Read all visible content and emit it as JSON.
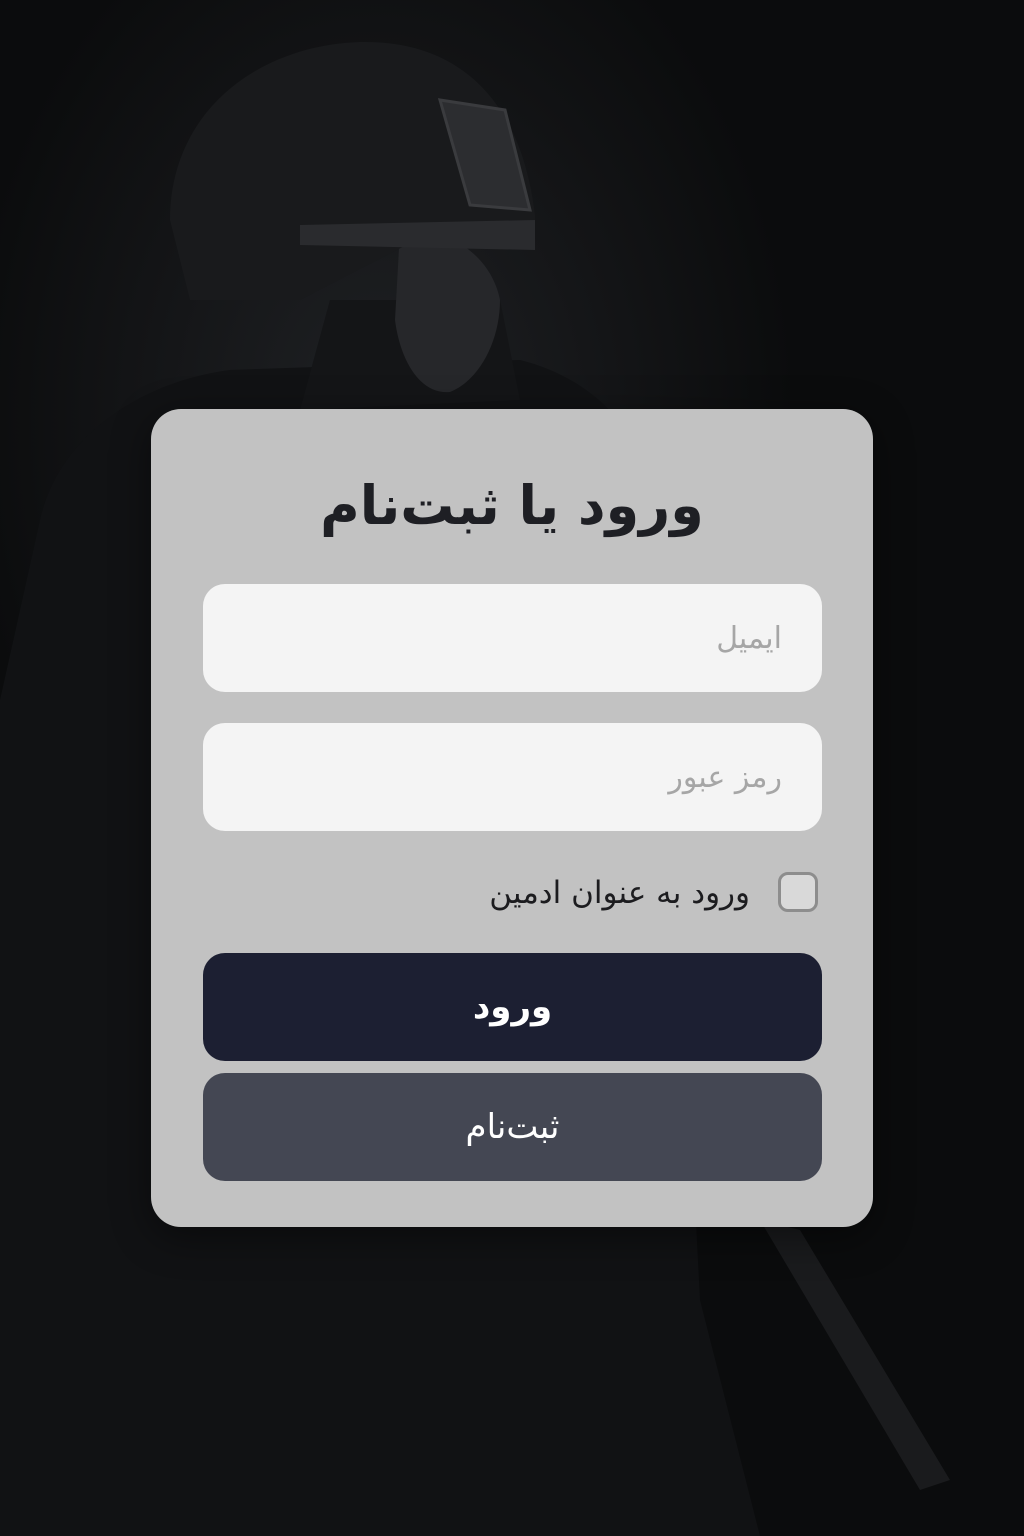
{
  "title": "ورود یا ثبت‌نام",
  "email_field": {
    "placeholder": "ایمیل",
    "value": ""
  },
  "password_field": {
    "placeholder": "رمز عبور",
    "value": ""
  },
  "admin_checkbox": {
    "label": "ورود به عنوان ادمین",
    "checked": false
  },
  "buttons": {
    "login_label": "ورود",
    "signup_label": "ثبت‌نام"
  },
  "colors": {
    "card_background": "#c2c2c2",
    "login_button": "#1c1f32",
    "signup_button": "#444753",
    "input_background": "#f4f4f4"
  }
}
